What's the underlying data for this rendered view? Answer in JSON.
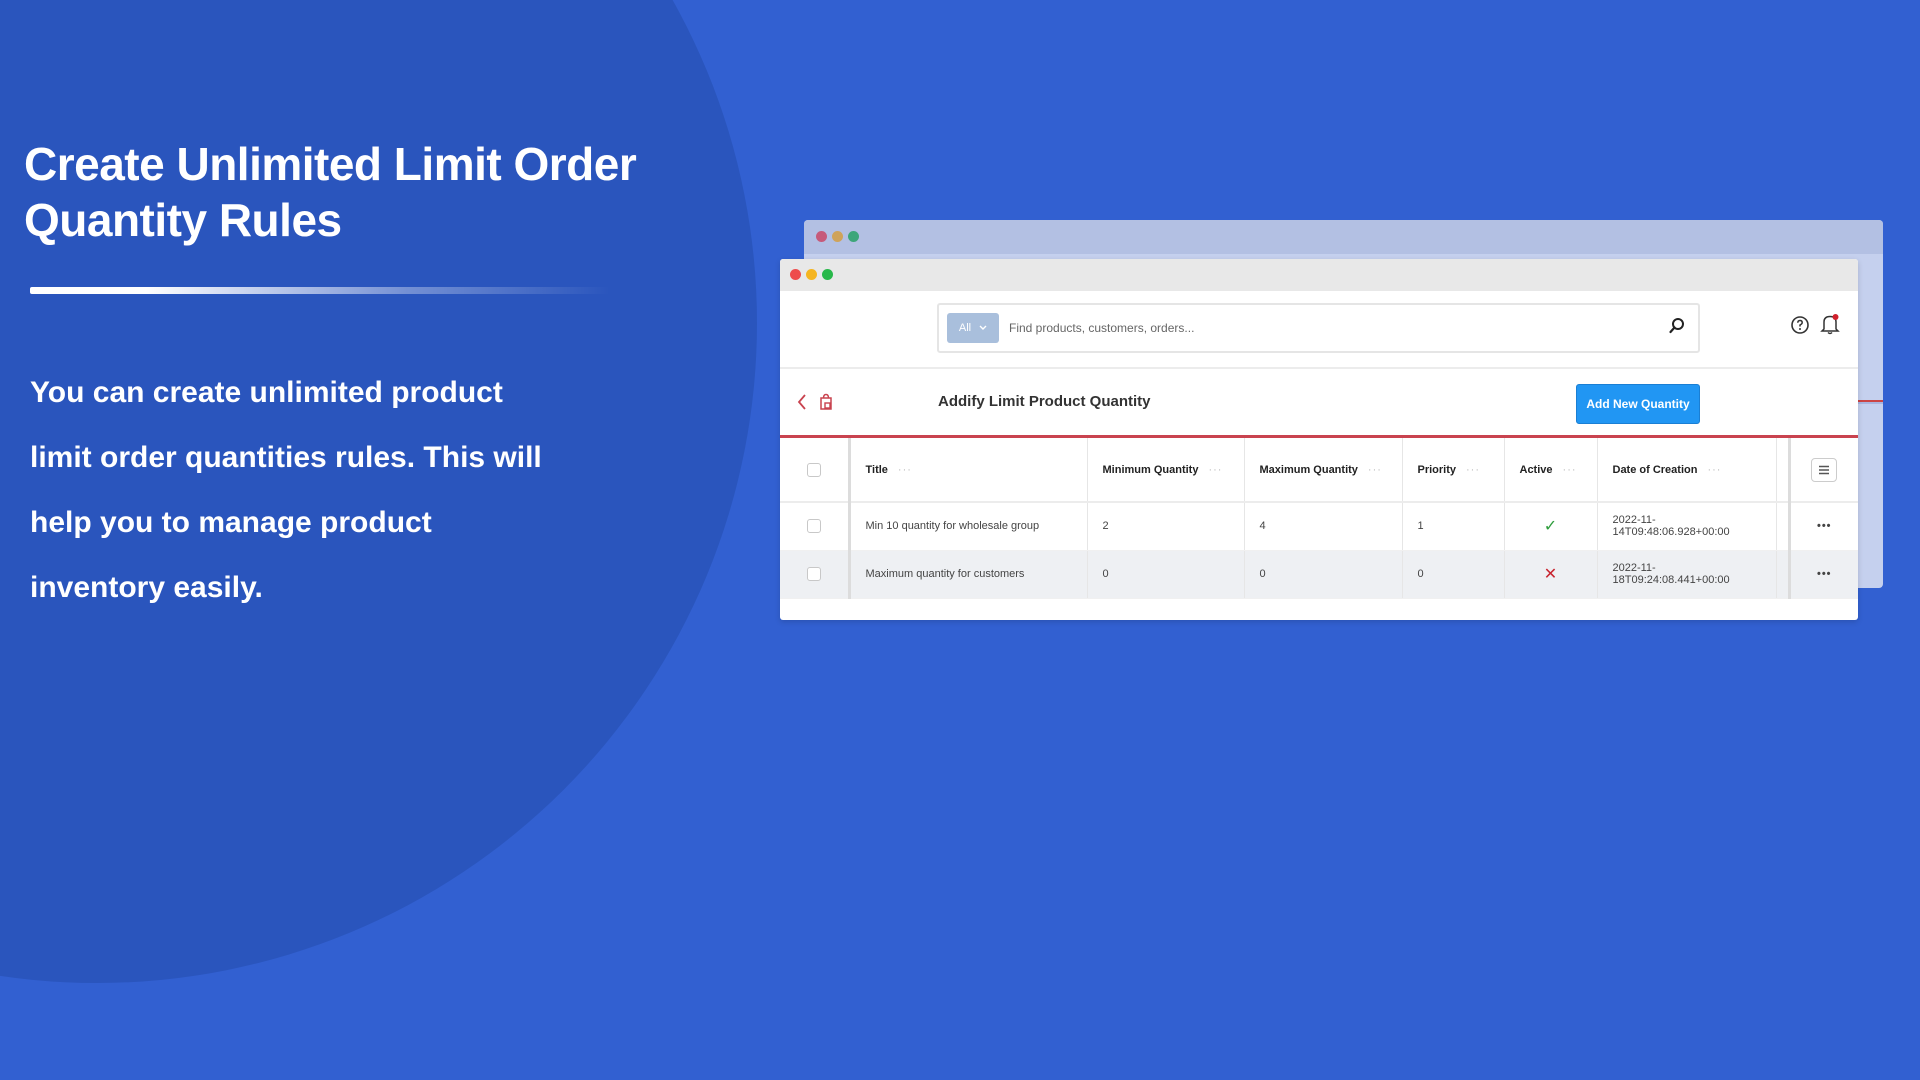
{
  "hero": {
    "title_line1": "Create Unlimited Limit Order",
    "title_line2": "Quantity Rules",
    "body_lines": [
      "You can create unlimited product",
      "limit order quantities rules. This will",
      "help you to manage product",
      "inventory easily."
    ]
  },
  "app": {
    "search": {
      "scope": "All",
      "placeholder": "Find products, customers, orders..."
    },
    "page_title": "Addify Limit Product Quantity",
    "add_button": "Add New Quantity",
    "table": {
      "columns": [
        "Title",
        "Minimum Quantity",
        "Maximum Quantity",
        "Priority",
        "Active",
        "Date of Creation"
      ],
      "column_more": "···",
      "row_more": "•••",
      "rows": [
        {
          "title": "Min 10 quantity for wholesale group",
          "min": "2",
          "max": "4",
          "priority": "1",
          "active": "✓",
          "date": "2022-11-14T09:48:06.928+00:00"
        },
        {
          "title": "Maximum quantity for customers",
          "min": "0",
          "max": "0",
          "priority": "0",
          "active": "✕",
          "date": "2022-11-18T09:24:08.441+00:00"
        }
      ]
    }
  },
  "colors": {
    "background": "#3260d1",
    "circle": "#2a55bd",
    "primary_button": "#2196f3",
    "accent_red": "#c9434f",
    "active_green": "#2e9d3c",
    "inactive_red": "#c8242f"
  }
}
